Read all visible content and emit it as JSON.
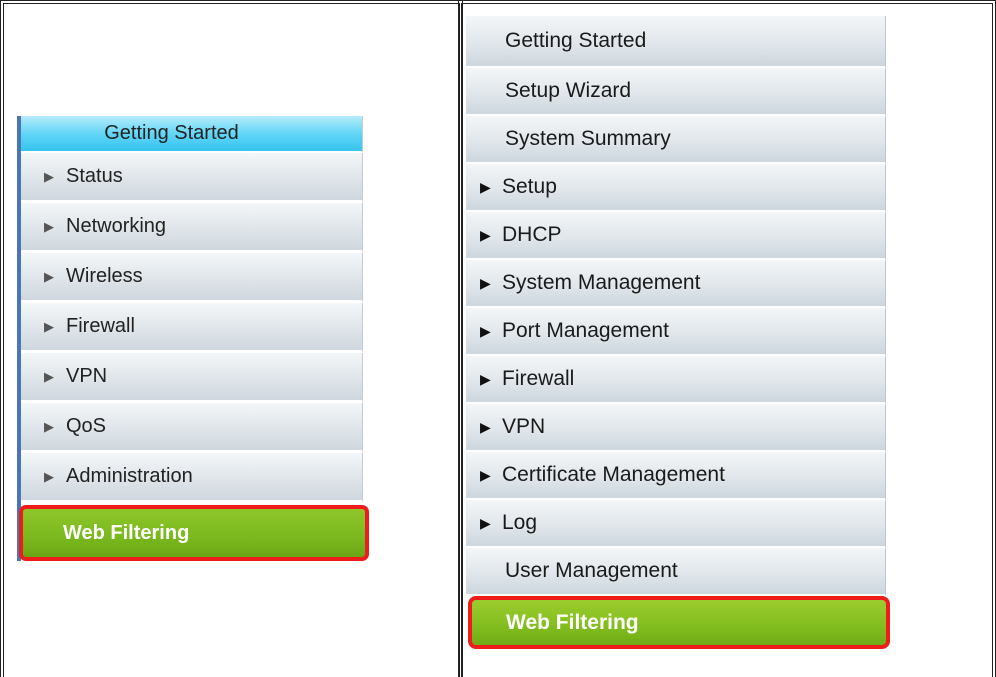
{
  "left_menu": {
    "top_item": "Getting Started",
    "items": [
      {
        "label": "Status",
        "arrow": "▶"
      },
      {
        "label": "Networking",
        "arrow": "▶"
      },
      {
        "label": "Wireless",
        "arrow": "▶"
      },
      {
        "label": "Firewall",
        "arrow": "▶"
      },
      {
        "label": "VPN",
        "arrow": "▶"
      },
      {
        "label": "QoS",
        "arrow": "▶"
      },
      {
        "label": "Administration",
        "arrow": "▶"
      }
    ],
    "highlighted": "Web Filtering"
  },
  "right_menu": {
    "plain_top": [
      "Getting Started",
      "Setup Wizard",
      "System Summary"
    ],
    "expandable": [
      {
        "label": "Setup",
        "arrow": "▶"
      },
      {
        "label": "DHCP",
        "arrow": "▶"
      },
      {
        "label": "System Management",
        "arrow": "▶"
      },
      {
        "label": "Port Management",
        "arrow": "▶"
      },
      {
        "label": "Firewall",
        "arrow": "▶"
      },
      {
        "label": "VPN",
        "arrow": "▶"
      },
      {
        "label": "Certificate Management",
        "arrow": "▶"
      },
      {
        "label": "Log",
        "arrow": "▶"
      }
    ],
    "plain_bottom": "User Management",
    "highlighted": "Web Filtering"
  },
  "colors": {
    "highlight_outline": "#ef1c1c",
    "web_filtering_bg": "#7ab81e",
    "getting_started_bg": "#5cd3f5",
    "menu_bg": "#dde3e8"
  }
}
